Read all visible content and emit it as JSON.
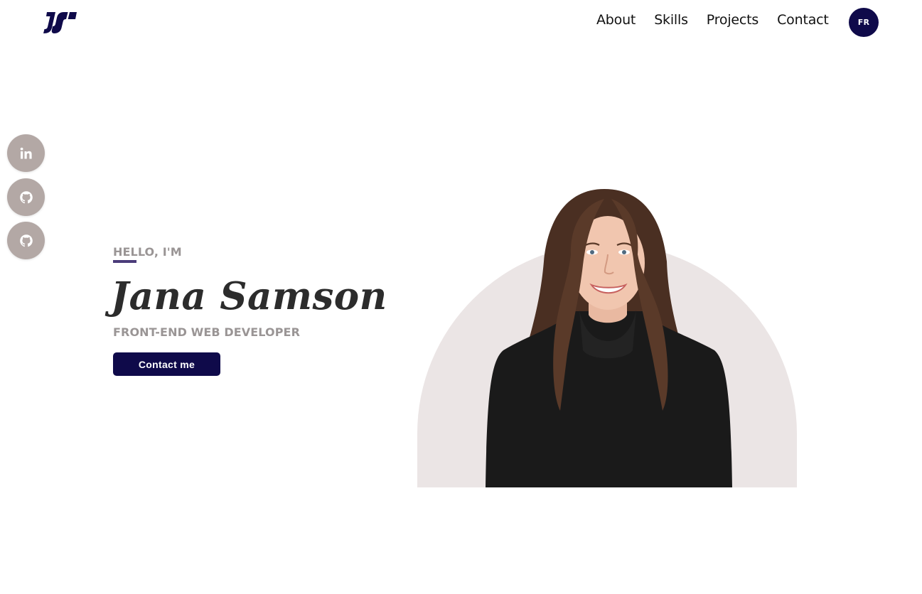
{
  "header": {
    "logo_text": "JS",
    "nav": [
      "About",
      "Skills",
      "Projects",
      "Contact"
    ],
    "language_button": "FR"
  },
  "social": [
    {
      "name": "linkedin",
      "icon": "linkedin-icon"
    },
    {
      "name": "github",
      "icon": "github-icon"
    },
    {
      "name": "github",
      "icon": "github-icon"
    }
  ],
  "intro": {
    "greeting": "HELLO, I'M",
    "name": "Jana Samson",
    "role": "FRONT-END WEB DEVELOPER",
    "cta": "Contact me"
  },
  "colors": {
    "brand": "#0f0a4a",
    "social_bg": "#b3a8a5",
    "arch_bg": "#ebe5e5",
    "accent_underline": "#4b3c7a",
    "muted_text": "#9a9595"
  }
}
